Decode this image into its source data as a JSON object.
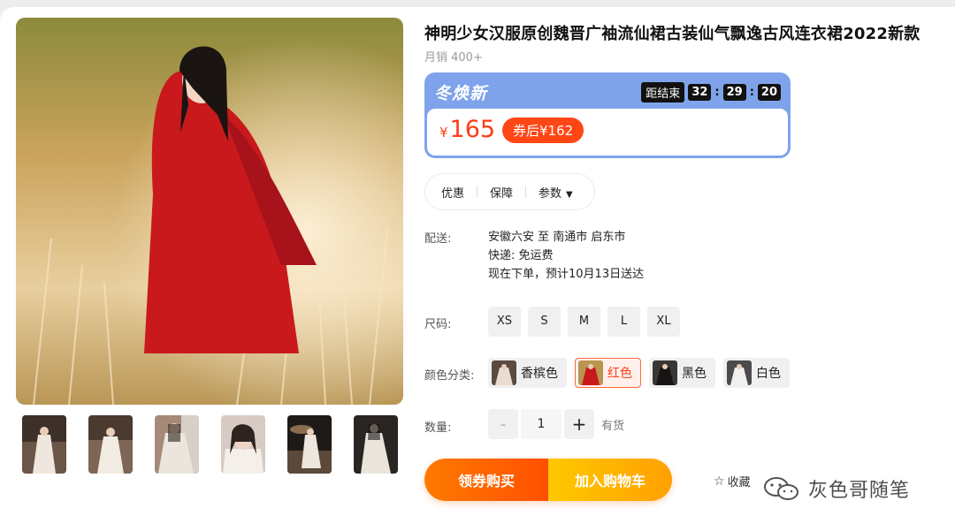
{
  "product": {
    "title": "神明少女汉服原创魏晋广袖流仙裙古装仙气飘逸古风连衣裙2022新款",
    "sales": "月销 400+"
  },
  "promo": {
    "brand": "冬焕新",
    "countdown_label": "距结束",
    "hours": "32",
    "minutes": "29",
    "seconds": "20",
    "currency": "¥",
    "price": "165",
    "coupon_price": "券后¥162",
    "colors": {
      "frame": "#7fa3ea",
      "price": "#ff3b16",
      "coupon_bg": "#ff4615"
    }
  },
  "tabs": {
    "discount": "优惠",
    "guarantee": "保障",
    "params": "参数"
  },
  "shipping": {
    "label": "配送:",
    "route": "安徽六安 至 南通市 启东市",
    "express": "快递: 免运费",
    "eta": "现在下单，预计10月13日送达"
  },
  "size": {
    "label": "尺码:",
    "options": [
      "XS",
      "S",
      "M",
      "L",
      "XL"
    ]
  },
  "color": {
    "label": "颜色分类:",
    "options": [
      "香槟色",
      "红色",
      "黑色",
      "白色"
    ],
    "selected": "红色"
  },
  "quantity": {
    "label": "数量:",
    "minus": "-",
    "value": "1",
    "plus": "+",
    "stock": "有货"
  },
  "actions": {
    "buy": "领券购买",
    "cart": "加入购物车",
    "favorite": "收藏",
    "colors": {
      "buy": "#ff5000",
      "cart": "#ffb000"
    }
  },
  "watermark": {
    "text": "灰色哥随笔"
  }
}
